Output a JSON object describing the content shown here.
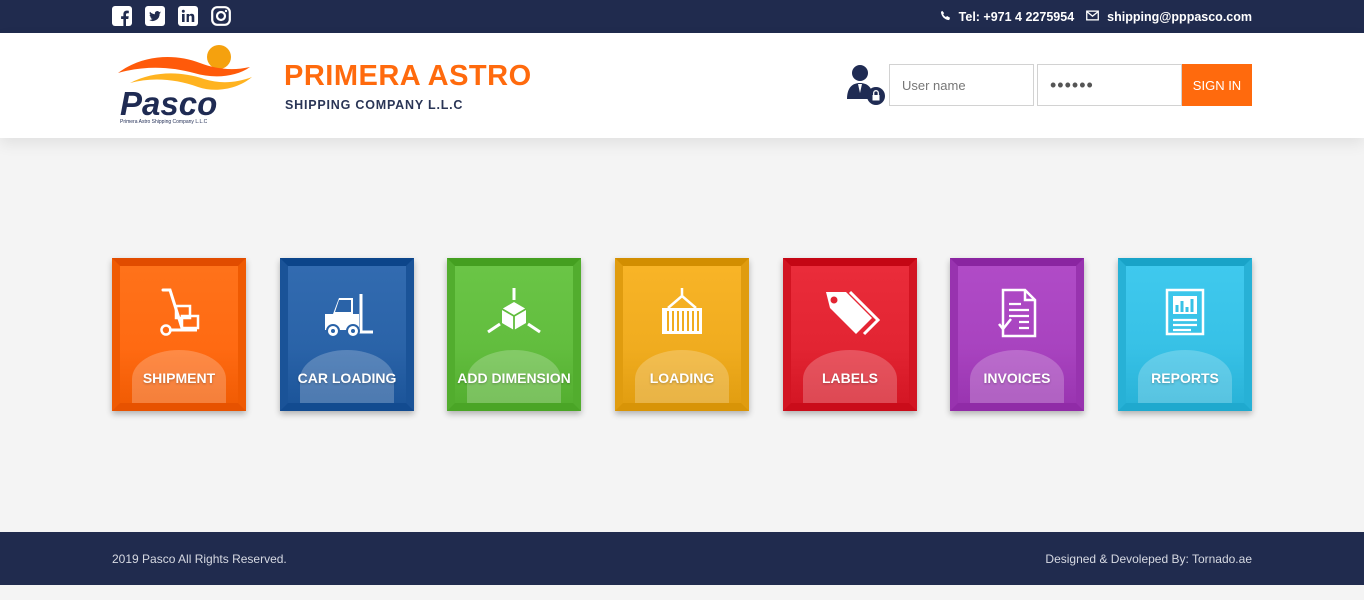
{
  "topbar": {
    "social": [
      {
        "icon": "facebook-icon"
      },
      {
        "icon": "twitter-icon"
      },
      {
        "icon": "linkedin-icon"
      },
      {
        "icon": "instagram-icon"
      }
    ],
    "phone_icon": "phone-icon",
    "phone": "Tel: +971 4 2275954",
    "email_icon": "envelope-icon",
    "email": "shipping@pppasco.com"
  },
  "header": {
    "logo": {
      "text": "Pasco",
      "tagline": "Primera Astro Shipping Company L.L.C"
    },
    "title": "PRIMERA ASTRO",
    "subtitle": "SHIPPING COMPANY L.L.C",
    "login": {
      "user_icon": "user-lock-icon",
      "username_placeholder": "User name",
      "password_value": "••••••",
      "signin_label": "SIGN IN"
    }
  },
  "tiles": [
    {
      "label": "SHIPMENT",
      "icon": "hand-truck-icon",
      "color": "#ff6a12"
    },
    {
      "label": "CAR LOADING",
      "icon": "forklift-icon",
      "color": "#2a63a8"
    },
    {
      "label": "ADD DIMENSION",
      "icon": "cube-dimension-icon",
      "color": "#62bd3e"
    },
    {
      "label": "LOADING",
      "icon": "container-crane-icon",
      "color": "#f0ac1f"
    },
    {
      "label": "LABELS",
      "icon": "tag-icon",
      "color": "#e22432"
    },
    {
      "label": "INVOICES",
      "icon": "invoice-icon",
      "color": "#a843bf"
    },
    {
      "label": "REPORTS",
      "icon": "report-icon",
      "color": "#37c1e6"
    }
  ],
  "footer": {
    "copyright": "2019 Pasco All Rights Reserved.",
    "credits": "Designed & Devoleped By: Tornado.ae"
  },
  "colors": {
    "navy": "#202b4e",
    "accent": "#ff6a0d"
  }
}
